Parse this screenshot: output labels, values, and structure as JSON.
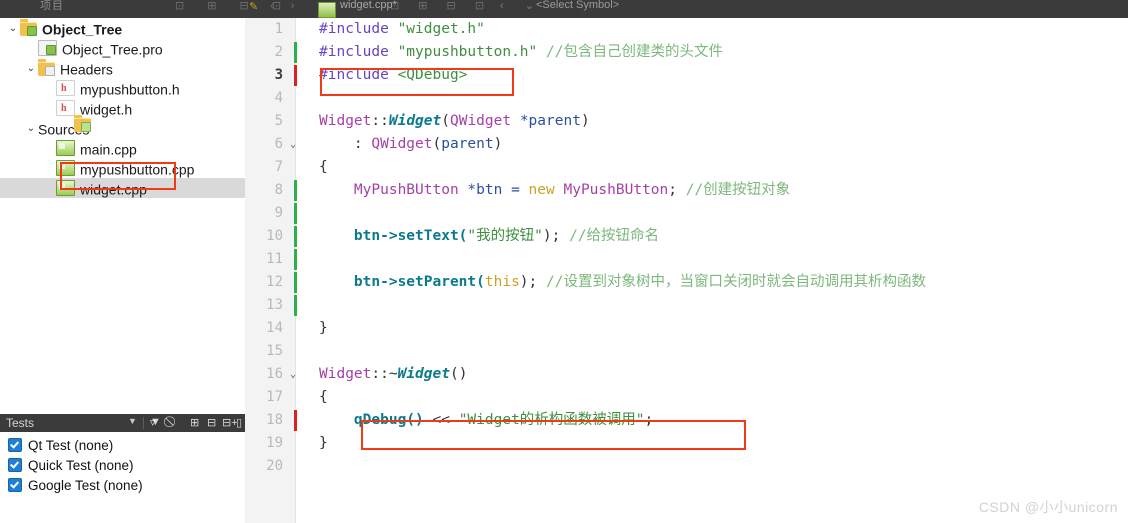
{
  "window": {
    "toolbar": {
      "left_label": "项目",
      "tab_title": "widget.cpp*",
      "symbol_selector": "<Select Symbol>",
      "tab_modified_icon": "pencil-icon",
      "icon_group_1": "⊡ ⊞ ⊟ ⊡",
      "icon_group_2": "⊡ ⊞ ⊟ ⊡",
      "nav_icons": "‹ ›",
      "symbol_caret": "‹ ⌄"
    }
  },
  "sidebar": {
    "items": [
      {
        "label": "Object_Tree",
        "icon": "folder-project-icon",
        "indent": 0,
        "twisty": "⌄",
        "bold": true,
        "selected": false
      },
      {
        "label": "Object_Tree.pro",
        "icon": "pro-file-icon",
        "indent": 1,
        "twisty": "",
        "bold": false,
        "selected": false
      },
      {
        "label": "Headers",
        "icon": "folder-headers-icon",
        "indent": 1,
        "twisty": "⌄",
        "bold": false,
        "selected": false
      },
      {
        "label": "mypushbutton.h",
        "icon": "header-file-icon",
        "indent": 2,
        "twisty": "",
        "bold": false,
        "selected": false
      },
      {
        "label": "widget.h",
        "icon": "header-file-icon",
        "indent": 2,
        "twisty": "",
        "bold": false,
        "selected": false
      },
      {
        "label": "Sources",
        "icon": "folder-sources-icon",
        "indent": 1,
        "twisty": "⌄",
        "bold": false,
        "selected": false
      },
      {
        "label": "main.cpp",
        "icon": "cpp-file-icon",
        "indent": 2,
        "twisty": "",
        "bold": false,
        "selected": false
      },
      {
        "label": "mypushbutton.cpp",
        "icon": "cpp-file-icon",
        "indent": 2,
        "twisty": "",
        "bold": false,
        "selected": false
      },
      {
        "label": "widget.cpp",
        "icon": "cpp-file-icon",
        "indent": 2,
        "twisty": "",
        "bold": false,
        "selected": true
      }
    ]
  },
  "tests_panel": {
    "title": "Tests",
    "toolbar_icons": [
      "filter-icon",
      "link-icon",
      "expand-all-icon",
      "collapse-all-icon",
      "run-tests-icon",
      "panel-icon"
    ],
    "items": [
      {
        "label": "Qt Test (none)",
        "checked": true
      },
      {
        "label": "Quick Test (none)",
        "checked": true
      },
      {
        "label": "Google Test (none)",
        "checked": true
      }
    ]
  },
  "editor": {
    "lines": [
      {
        "n": "1",
        "fold": "",
        "change": "",
        "current": false
      },
      {
        "n": "2",
        "fold": "",
        "change": "green",
        "current": false
      },
      {
        "n": "3",
        "fold": "",
        "change": "red",
        "current": true
      },
      {
        "n": "4",
        "fold": "",
        "change": "",
        "current": false
      },
      {
        "n": "5",
        "fold": "",
        "change": "",
        "current": false
      },
      {
        "n": "6",
        "fold": "⌄",
        "change": "",
        "current": false
      },
      {
        "n": "7",
        "fold": "",
        "change": "",
        "current": false
      },
      {
        "n": "8",
        "fold": "",
        "change": "green",
        "current": false
      },
      {
        "n": "9",
        "fold": "",
        "change": "green",
        "current": false
      },
      {
        "n": "10",
        "fold": "",
        "change": "green",
        "current": false
      },
      {
        "n": "11",
        "fold": "",
        "change": "green",
        "current": false
      },
      {
        "n": "12",
        "fold": "",
        "change": "green",
        "current": false
      },
      {
        "n": "13",
        "fold": "",
        "change": "green",
        "current": false
      },
      {
        "n": "14",
        "fold": "",
        "change": "",
        "current": false
      },
      {
        "n": "15",
        "fold": "",
        "change": "",
        "current": false
      },
      {
        "n": "16",
        "fold": "⌄",
        "change": "",
        "current": false
      },
      {
        "n": "17",
        "fold": "",
        "change": "",
        "current": false
      },
      {
        "n": "18",
        "fold": "",
        "change": "red",
        "current": false
      },
      {
        "n": "19",
        "fold": "",
        "change": "",
        "current": false
      },
      {
        "n": "20",
        "fold": "",
        "change": "",
        "current": false
      }
    ],
    "code": {
      "l1_include": "#include",
      "l1_file": "\"widget.h\"",
      "l2_include": "#include",
      "l2_file": "\"mypushbutton.h\"",
      "l2_comment": "//包含自己创建类的头文件",
      "l3_include": "#include",
      "l3_file": "<QDebug>",
      "l5_class": "Widget",
      "l5_scope": "::",
      "l5_ctor": "Widget",
      "l5_args": "(QWidget *parent)",
      "l5_argtype": "QWidget",
      "l5_argname": "*parent",
      "l6_init": ": QWidget(parent)",
      "l6_base": "QWidget",
      "l6_param": "parent",
      "l7_brace": "{",
      "l8_type": "MyPushBUtton",
      "l8_var": "*btn =",
      "l8_new": "new",
      "l8_ctor": "MyPushBUtton",
      "l8_semi": ";",
      "l8_comment": "//创建按钮对象",
      "l10_call": "btn->setText(",
      "l10_str": "\"我的按钮\"",
      "l10_tail": ");",
      "l10_comment": "//给按钮命名",
      "l12_call": "btn->setParent(",
      "l12_this": "this",
      "l12_tail": ");",
      "l12_comment": "//设置到对象树中，当窗口关闭时就会自动调用其析构函数",
      "l14_brace": "}",
      "l16_class": "Widget",
      "l16_scope": "::~",
      "l16_dtor": "Widget",
      "l16_args": "()",
      "l17_brace": "{",
      "l18_call": "qDebug()",
      "l18_op": "<<",
      "l18_str": "\"Widget的析构函数被调用\"",
      "l18_semi": ";",
      "l19_brace": "}"
    }
  },
  "annotations": {
    "accent_color": "#f03a17",
    "boxes": [
      "widget-cpp-file",
      "include-qdebug-line",
      "qdebug-output-line"
    ]
  },
  "watermark": {
    "text": "CSDN @小小unicorn"
  }
}
